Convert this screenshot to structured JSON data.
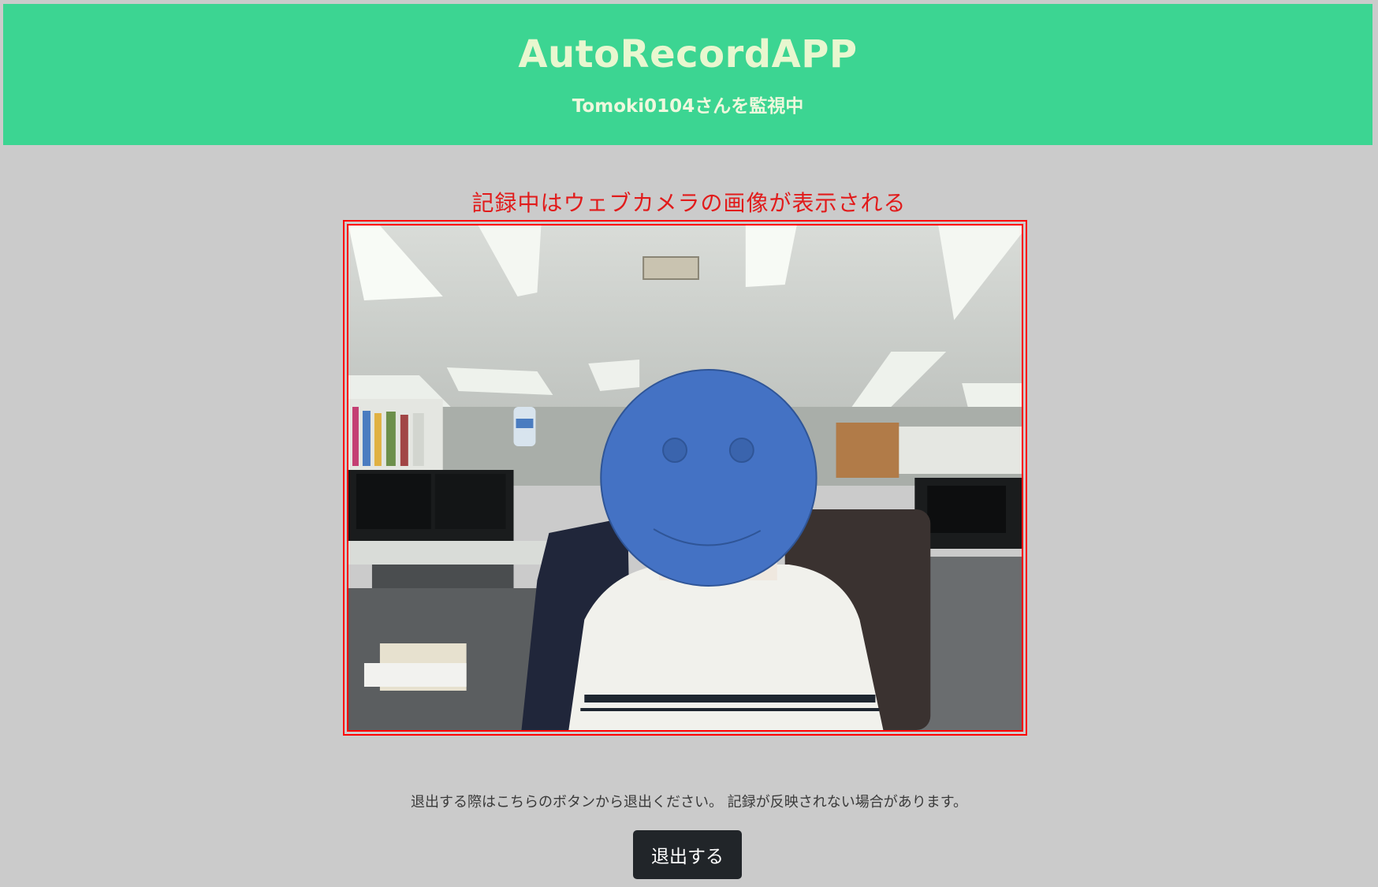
{
  "header": {
    "title": "AutoRecordAPP",
    "subtitle": "Tomoki0104さんを監視中",
    "background_color": "#3cd592"
  },
  "camera": {
    "caption": "記録中はウェブカメラの画像が表示される",
    "caption_color": "#e11b1b",
    "border_color": "#ff0000",
    "overlay_icon": "smiley-face-icon"
  },
  "footer": {
    "notice": "退出する際はこちらのボタンから退出ください。 記録が反映されない場合があります。",
    "exit_label": "退出する",
    "button_color": "#212529"
  }
}
